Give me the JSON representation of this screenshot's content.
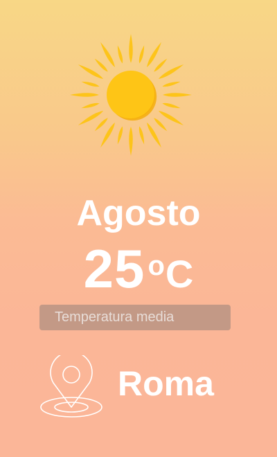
{
  "weather": {
    "month": "Agosto",
    "temperature": "25",
    "degree_symbol": "o",
    "unit": "C",
    "caption": "Temperatura media",
    "city": "Roma",
    "condition_icon": "sun-icon",
    "location_icon": "map-pin-icon"
  },
  "colors": {
    "background_top": "#f8d786",
    "background_bottom": "#fbb698",
    "sun_core": "#fec516",
    "sun_ray": "#fdc41a",
    "caption_box": "#96827a"
  }
}
